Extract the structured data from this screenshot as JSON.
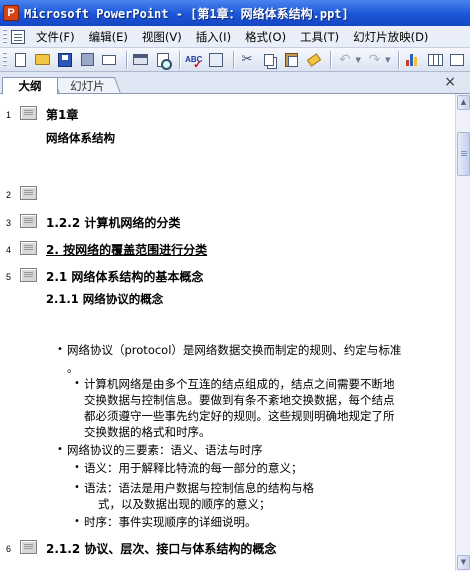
{
  "window": {
    "title": "Microsoft PowerPoint - [第1章：网络体系结构.ppt]",
    "app_icon_letter": "P"
  },
  "menu": {
    "items": [
      "文件(F)",
      "编辑(E)",
      "视图(V)",
      "插入(I)",
      "格式(O)",
      "工具(T)",
      "幻灯片放映(D)"
    ]
  },
  "toolbar": {
    "buttons": [
      "new-icon",
      "open-icon",
      "save-icon",
      "permission-icon",
      "email-icon",
      "print-icon",
      "print-preview-icon",
      "spelling-icon",
      "research-icon",
      "cut-icon",
      "copy-icon",
      "paste-icon",
      "format-painter-icon",
      "undo-icon",
      "redo-icon",
      "insert-chart-icon",
      "insert-table-icon",
      "tables-borders-icon"
    ],
    "spelling_label": "ABC"
  },
  "tabs": {
    "outline": "大纲",
    "slides": "幻灯片",
    "close": "×"
  },
  "outline": {
    "slides": [
      {
        "num": "1",
        "title": "第1章",
        "subtitle": "网络体系结构"
      },
      {
        "num": "2",
        "title": ""
      },
      {
        "num": "3",
        "title": "1.2.2 计算机网络的分类"
      },
      {
        "num": "4",
        "title": "2. 按网络的覆盖范围进行分类"
      },
      {
        "num": "5",
        "title": "2.1  网络体系结构的基本概念",
        "subtitle": "2.1.1  网络协议的概念"
      },
      {
        "num": "6",
        "title": "2.1.2  协议、层次、接口与体系结构的概念"
      }
    ],
    "bullets": [
      "网络协议（protocol）是网络数据交换而制定的规则、约定与标准",
      "。",
      "计算机网络是由多个互连的结点组成的，结点之间需要不断地",
      "交换数据与控制信息。要做到有条不紊地交换数据，每个结点",
      "都必须遵守一些事先约定好的规则。这些规则明确地规定了所",
      "交换数据的格式和时序。",
      "网络协议的三要素：语义、语法与时序",
      "语义：用于解释比特流的每一部分的意义；",
      "语法：语法是用户数据与控制信息的结构与格",
      "式，以及数据出现的顺序的意义；",
      "时序：事件实现顺序的详细说明。"
    ]
  },
  "scrollbar": {
    "up": "▲",
    "down": "▼"
  }
}
